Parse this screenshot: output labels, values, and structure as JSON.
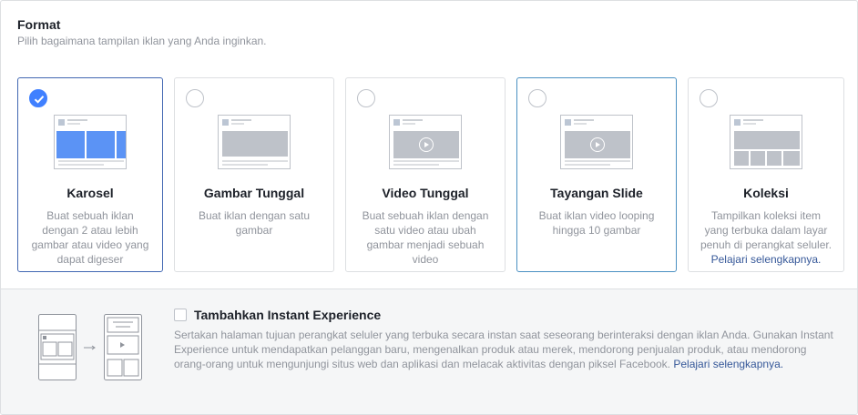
{
  "section": {
    "title": "Format",
    "subtitle": "Pilih bagaimana tampilan iklan yang Anda inginkan."
  },
  "formats": [
    {
      "name": "Karosel",
      "description": "Buat sebuah iklan dengan 2 atau lebih gambar atau video yang dapat digeser",
      "selected": true,
      "thumbnail_icon": "carousel-preview-icon"
    },
    {
      "name": "Gambar Tunggal",
      "description": "Buat iklan dengan satu gambar",
      "selected": false,
      "thumbnail_icon": "single-image-preview-icon"
    },
    {
      "name": "Video Tunggal",
      "description": "Buat sebuah iklan dengan satu video atau ubah gambar menjadi sebuah video",
      "selected": false,
      "thumbnail_icon": "single-video-preview-icon"
    },
    {
      "name": "Tayangan Slide",
      "description": "Buat iklan video looping hingga 10 gambar",
      "selected": false,
      "thumbnail_icon": "slideshow-preview-icon"
    },
    {
      "name": "Koleksi",
      "description": "Tampilkan koleksi item yang terbuka dalam layar penuh di perangkat seluler.",
      "link": "Pelajari selengkapnya.",
      "selected": false,
      "thumbnail_icon": "collection-preview-icon"
    }
  ],
  "instant_experience": {
    "checkbox_label": "Tambahkan Instant Experience",
    "checked": false,
    "description": "Sertakan halaman tujuan perangkat seluler yang terbuka secara instan saat seseorang berinteraksi dengan iklan Anda. Gunakan Instant Experience untuk mendapatkan pelanggan baru, mengenalkan produk atau merek, mendorong penjualan produk, atau mendorong orang-orang untuk mengunjungi situs web dan aplikasi dan melacak aktivitas dengan piksel Facebook.",
    "link": "Pelajari selengkapnya."
  },
  "colors": {
    "accent": "#4080ff",
    "link": "#365899",
    "muted_text": "#90949c",
    "border": "#dddfe2",
    "footer_bg": "#f5f6f7"
  }
}
